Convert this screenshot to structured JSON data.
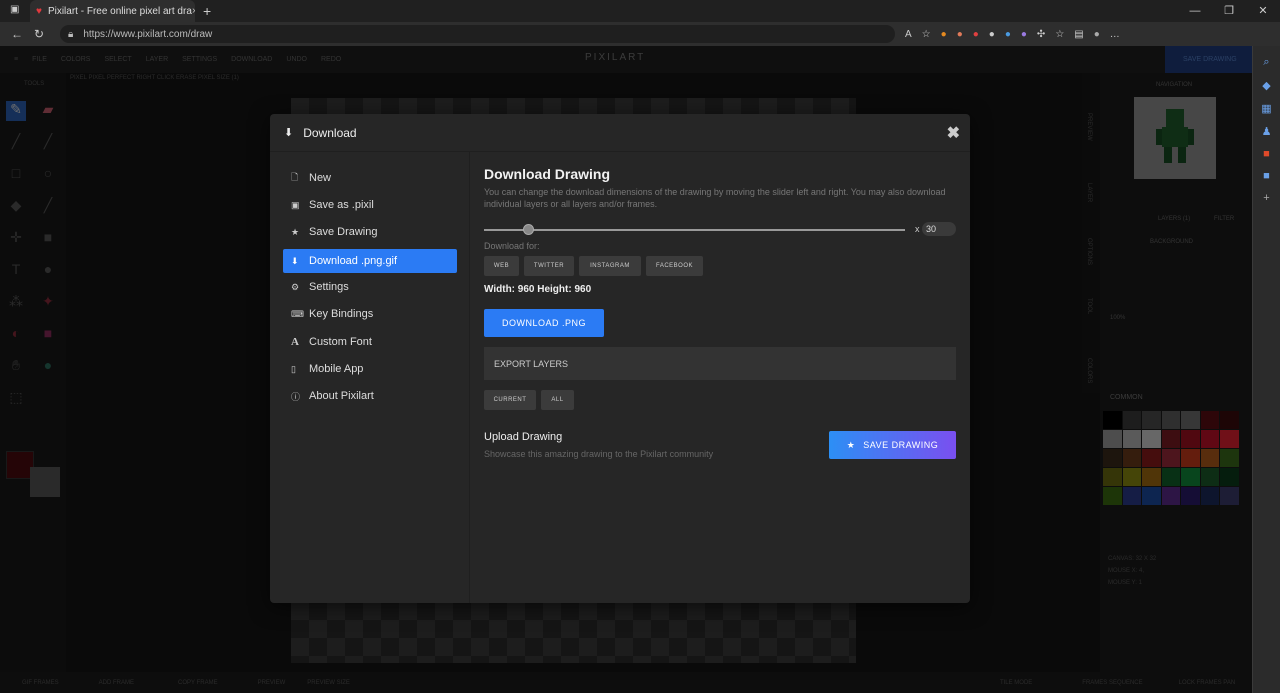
{
  "browser": {
    "tab_title": "Pixilart - Free online pixel art dra",
    "tab_close": "×",
    "new_tab": "+",
    "url": "https://www.pixilart.com/draw",
    "window_buttons": [
      "—",
      "❐",
      "✕"
    ]
  },
  "app": {
    "logo": "PIXILART",
    "menu": [
      "FILE",
      "COLORS",
      "SELECT",
      "LAYER",
      "SETTINGS",
      "DOWNLOAD",
      "UNDO",
      "REDO"
    ],
    "save_top": "SAVE DRAWING",
    "options_bar": "PIXEL     PIXEL PERFECT     RIGHT CLICK ERASE    PIXEL SIZE (1)",
    "tools_label": "TOOLS",
    "bottom_bar": [
      "GIF FRAMES",
      "ADD FRAME",
      "COPY FRAME",
      "PREVIEW",
      "PREVIEW SIZE",
      "TILE MODE",
      "FRAMES SEQUENCE",
      "LOCK FRAMES PAN"
    ],
    "right_panel": {
      "navigation": "NAVIGATION",
      "layers": "LAYERS (1)",
      "filter": "FILTER",
      "background": "BACKGROUND",
      "zoom": "100%",
      "common": "COMMON",
      "canvas_info": "CANVAS: 32 X 32",
      "mouse_x": "MOUSE X: 4,",
      "mouse_y": "MOUSE Y: 1"
    },
    "side_tabs": [
      "PREVIEW",
      "LAYER",
      "OPTIONS",
      "TOOL",
      "COLORS"
    ],
    "palette_colors": [
      "#000000",
      "#3a3a3a",
      "#4d4d4d",
      "#5e5e5e",
      "#6e6e6e",
      "#5a0d12",
      "#3a0a0d",
      "#9a9a9a",
      "#b5b5b5",
      "#cfcfcf",
      "#7a1a22",
      "#a01020",
      "#c01028",
      "#e02030",
      "#3a2a1a",
      "#6a3a1a",
      "#8a1a1a",
      "#9a2a3a",
      "#c83a1a",
      "#b05a1a",
      "#3a6a1a",
      "#6a6a10",
      "#8a8a10",
      "#a06a10",
      "#10602a",
      "#108a3a",
      "#1a5a2a",
      "#0a3a1a",
      "#3a6a10",
      "#2a3a8a",
      "#1a4aa0",
      "#5a2a8a",
      "#2a1a6a",
      "#1a2a5a",
      "#3a3a6a"
    ]
  },
  "modal": {
    "title": "Download",
    "close": "✖",
    "menu": [
      {
        "label": "New",
        "icon": "file-icon"
      },
      {
        "label": "Save as .pixil",
        "icon": "floppy-icon"
      },
      {
        "label": "Save Drawing",
        "icon": "star-icon"
      },
      {
        "label": "Download .png.gif",
        "icon": "download-icon",
        "active": true
      },
      {
        "label": "Settings",
        "icon": "gears-icon"
      },
      {
        "label": "Key Bindings",
        "icon": "keyboard-icon"
      },
      {
        "label": "Custom Font",
        "icon": "font-icon"
      },
      {
        "label": "Mobile App",
        "icon": "mobile-icon"
      },
      {
        "label": "About Pixilart",
        "icon": "info-icon"
      }
    ],
    "heading": "Download Drawing",
    "description": "You can change the download dimensions of the drawing by moving the slider left and right. You may also download individual layers or all layers and/or frames.",
    "scale_prefix": "x",
    "scale_value": "30",
    "download_for_label": "Download for:",
    "targets": [
      "WEB",
      "TWITTER",
      "INSTAGRAM",
      "FACEBOOK"
    ],
    "dimensions": "Width: 960 Height: 960",
    "download_button": "DOWNLOAD .PNG",
    "export_layers": "EXPORT LAYERS",
    "layer_options": [
      "CURRENT",
      "ALL"
    ],
    "upload_title": "Upload Drawing",
    "upload_desc": "Showcase this amazing drawing to the Pixilart community",
    "save_button": "SAVE DRAWING"
  }
}
